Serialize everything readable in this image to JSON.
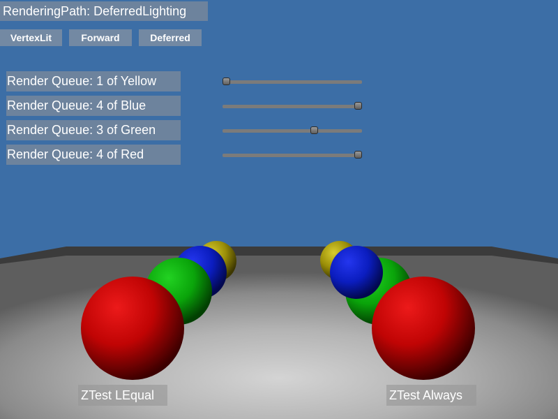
{
  "header": {
    "title": "RenderingPath: DeferredLighting"
  },
  "buttons": [
    {
      "label": "VertexLit"
    },
    {
      "label": "Forward"
    },
    {
      "label": "Deferred"
    }
  ],
  "sliders": [
    {
      "label": "Render Queue: 1  of Yellow",
      "value": 1,
      "min": 1,
      "max": 4
    },
    {
      "label": "Render Queue: 4  of Blue",
      "value": 4,
      "min": 1,
      "max": 4
    },
    {
      "label": "Render Queue: 3  of Green",
      "value": 3,
      "min": 1,
      "max": 4
    },
    {
      "label": "Render Queue: 4  of Red",
      "value": 4,
      "min": 1,
      "max": 4
    }
  ],
  "labels": {
    "left": "ZTest LEqual",
    "right": "ZTest Always"
  },
  "colors": {
    "sky": "#3c6ea6",
    "yellow": "#b8aa10",
    "blue": "#0b1fc8",
    "green": "#0aa80a",
    "red": "#c40606"
  }
}
